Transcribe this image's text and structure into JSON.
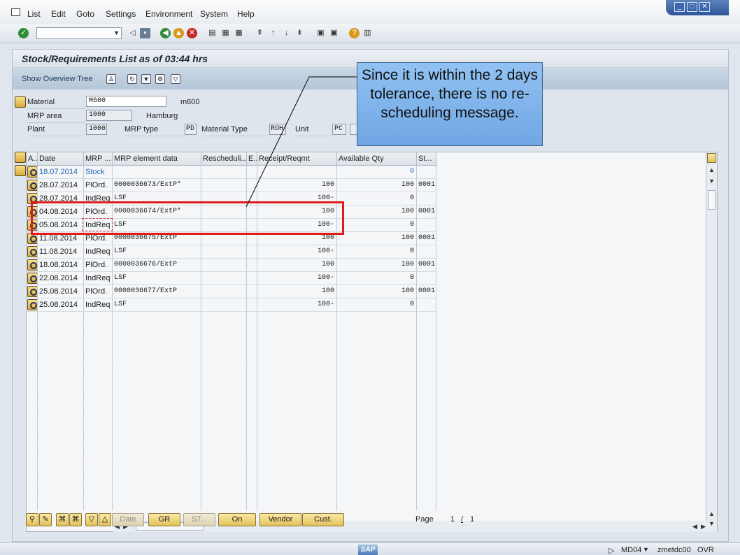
{
  "menu": [
    "List",
    "Edit",
    "Goto",
    "Settings",
    "Environment",
    "System",
    "Help"
  ],
  "title": "Stock/Requirements List as of 03:44 hrs",
  "app_toolbar": {
    "overview_tree": "Show Overview Tree"
  },
  "header": {
    "material_label": "Material",
    "material_value": "M600",
    "material_desc": "m600",
    "mrp_area_label": "MRP area",
    "mrp_area_value": "1000",
    "mrp_area_desc": "Hamburg",
    "plant_label": "Plant",
    "plant_value": "1000",
    "mrp_type_label": "MRP type",
    "mrp_type_value": "PD",
    "material_type_label": "Material Type",
    "material_type_value": "ROH",
    "unit_label": "Unit",
    "unit_value": "PC"
  },
  "columns": [
    "A..",
    "Date",
    "MRP ...",
    "MRP element data",
    "Rescheduli...",
    "E..",
    "Receipt/Reqmt",
    "Available Qty",
    "St..."
  ],
  "rows": [
    {
      "date": "18.07.2014",
      "mrp": "Stock",
      "data": "",
      "resched": "",
      "e": "",
      "receipt": "",
      "avail": "0",
      "st": "",
      "stock": true
    },
    {
      "date": "28.07.2014",
      "mrp": "PlOrd.",
      "data": "0000036673/ExtP*",
      "resched": "",
      "e": "",
      "receipt": "100",
      "avail": "100",
      "st": "0001"
    },
    {
      "date": "28.07.2014",
      "mrp": "IndReq",
      "data": "LSF",
      "resched": "",
      "e": "",
      "receipt": "100-",
      "avail": "0",
      "st": ""
    },
    {
      "date": "04.08.2014",
      "mrp": "PlOrd.",
      "data": "0000036674/ExtP*",
      "resched": "",
      "e": "",
      "receipt": "100",
      "avail": "100",
      "st": "0001"
    },
    {
      "date": "05.08.2014",
      "mrp": "IndReq",
      "data": "LSF",
      "resched": "",
      "e": "",
      "receipt": "100-",
      "avail": "0",
      "st": ""
    },
    {
      "date": "11.08.2014",
      "mrp": "PlOrd.",
      "data": "0000036675/ExtP",
      "resched": "",
      "e": "",
      "receipt": "100",
      "avail": "100",
      "st": "0001"
    },
    {
      "date": "11.08.2014",
      "mrp": "IndReq",
      "data": "LSF",
      "resched": "",
      "e": "",
      "receipt": "100-",
      "avail": "0",
      "st": ""
    },
    {
      "date": "18.08.2014",
      "mrp": "PlOrd.",
      "data": "0000036676/ExtP",
      "resched": "",
      "e": "",
      "receipt": "100",
      "avail": "100",
      "st": "0001"
    },
    {
      "date": "22.08.2014",
      "mrp": "IndReq",
      "data": "LSF",
      "resched": "",
      "e": "",
      "receipt": "100-",
      "avail": "0",
      "st": ""
    },
    {
      "date": "25.08.2014",
      "mrp": "PlOrd.",
      "data": "0000036677/ExtP",
      "resched": "",
      "e": "",
      "receipt": "100",
      "avail": "100",
      "st": "0001"
    },
    {
      "date": "25.08.2014",
      "mrp": "IndReq",
      "data": "LSF",
      "resched": "",
      "e": "",
      "receipt": "100-",
      "avail": "0",
      "st": ""
    }
  ],
  "bottom_buttons": {
    "date": "Date",
    "gr": "GR",
    "st": "ST...",
    "on": "On",
    "vendor": "Vendor",
    "cust": "Cust."
  },
  "pager": {
    "label": "Page",
    "current": "1",
    "sep": "/",
    "total": "1"
  },
  "callout": "Since it is within the 2 days tolerance, there is no re-scheduling message.",
  "status": {
    "transaction": "MD04",
    "server": "zmetdc00",
    "mode": "OVR",
    "logo": "SAP"
  },
  "colors": {
    "highlight": "#e21b1b",
    "callout_bg": "#7fb3ea",
    "stock_text": "#2767b8"
  }
}
